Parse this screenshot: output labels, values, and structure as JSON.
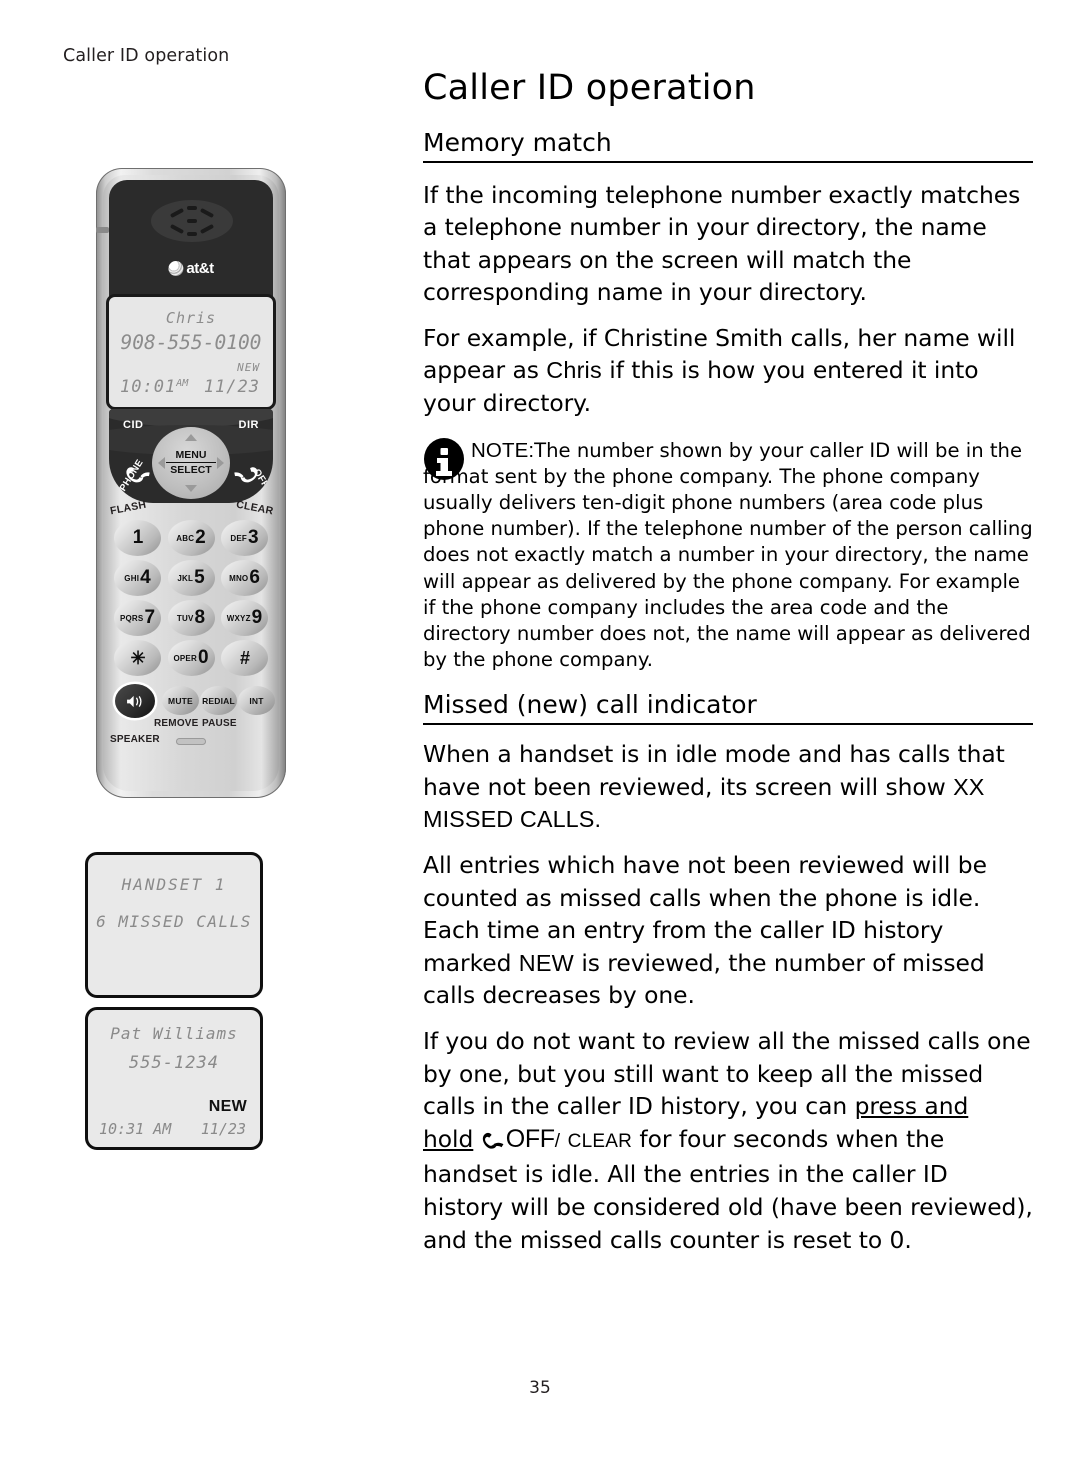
{
  "running_head": "Caller ID operation",
  "page_number": "35",
  "chapter_title": "Caller ID operation",
  "sections": {
    "memory_match": {
      "title": "Memory match",
      "para1": "If the incoming telephone number exactly matches a telephone number in your directory, the name that appears on the screen will match the corresponding name in your directory.",
      "para2_a": "For example, if Christine Smith calls, her name will appear as ",
      "para2_lcd": "Chris",
      "para2_b": " if this is how you entered it into your directory."
    },
    "note": {
      "label": "NOTE:",
      "text": "The number shown by your caller ID will be in the format sent by the phone company. The phone company usually delivers ten-digit phone numbers (area code plus phone number). If the telephone number of the person calling does not exactly match a number in your directory, the name will appear as delivered by the phone company. For example if the phone company includes the area code and the directory number does not, the name will appear as delivered by the phone company.",
      "icon": "info-icon"
    },
    "missed_call": {
      "title": "Missed (new) call indicator",
      "para1_a": "When a handset is in idle mode and has calls that have not been reviewed, its screen will show ",
      "para1_caps": "XX MISSED CALLS.",
      "para2_a": "All entries which have not been reviewed will be counted as missed calls when the phone is idle. Each time an entry from the caller ID history marked ",
      "para2_new": "NEW",
      "para2_b": " is reviewed, the number of missed calls decreases by one.",
      "para3_a": "If you do not want to review all the missed calls one by one, but you still want to keep all the missed calls in the caller ID history, you can ",
      "para3_underline": "press and hold",
      "para3_icon": "hangup-phone-icon",
      "para3_off": "OFF",
      "para3_slash": "/",
      "para3_clear": "CLEAR",
      "para3_b": " for four seconds when the handset is idle. All the entries in the caller ID history will be considered old (have been reviewed), and the missed calls counter is reset to 0."
    }
  },
  "phone": {
    "brand": "at&t",
    "lcd": {
      "name": "Chris",
      "number": "908-555-0100",
      "new_flag": "NEW",
      "time": "10:01",
      "ampm": "AM",
      "date": "11/23"
    },
    "controls": {
      "cid": "CID",
      "dir": "DIR",
      "menu": "MENU",
      "select": "SELECT",
      "phone": "PHONE",
      "off": "OFF",
      "flash": "FLASH",
      "clear": "CLEAR"
    },
    "keys": [
      [
        {
          "letters": "",
          "digit": "1"
        },
        {
          "letters": "ABC",
          "digit": "2"
        },
        {
          "letters": "DEF",
          "digit": "3"
        }
      ],
      [
        {
          "letters": "GHI",
          "digit": "4"
        },
        {
          "letters": "JKL",
          "digit": "5"
        },
        {
          "letters": "MNO",
          "digit": "6"
        }
      ],
      [
        {
          "letters": "PQRS",
          "digit": "7"
        },
        {
          "letters": "TUV",
          "digit": "8"
        },
        {
          "letters": "WXYZ",
          "digit": "9"
        }
      ],
      [
        {
          "letters": "",
          "digit": "✳"
        },
        {
          "letters": "OPER",
          "digit": "0"
        },
        {
          "letters": "",
          "digit": "#"
        }
      ]
    ],
    "function_keys": {
      "speaker": "SPEAKER",
      "mute": "MUTE",
      "remove": "REMOVE",
      "redial": "REDIAL",
      "pause": "PAUSE",
      "int": "INT"
    }
  },
  "lcd_figures": {
    "handset": {
      "line1": "HANDSET 1",
      "line2": "6 MISSED CALLS"
    },
    "pat_williams": {
      "line1": "Pat Williams",
      "line2": "555-1234",
      "new_flag": "NEW",
      "time": "10:31 AM",
      "date": "11/23"
    }
  }
}
